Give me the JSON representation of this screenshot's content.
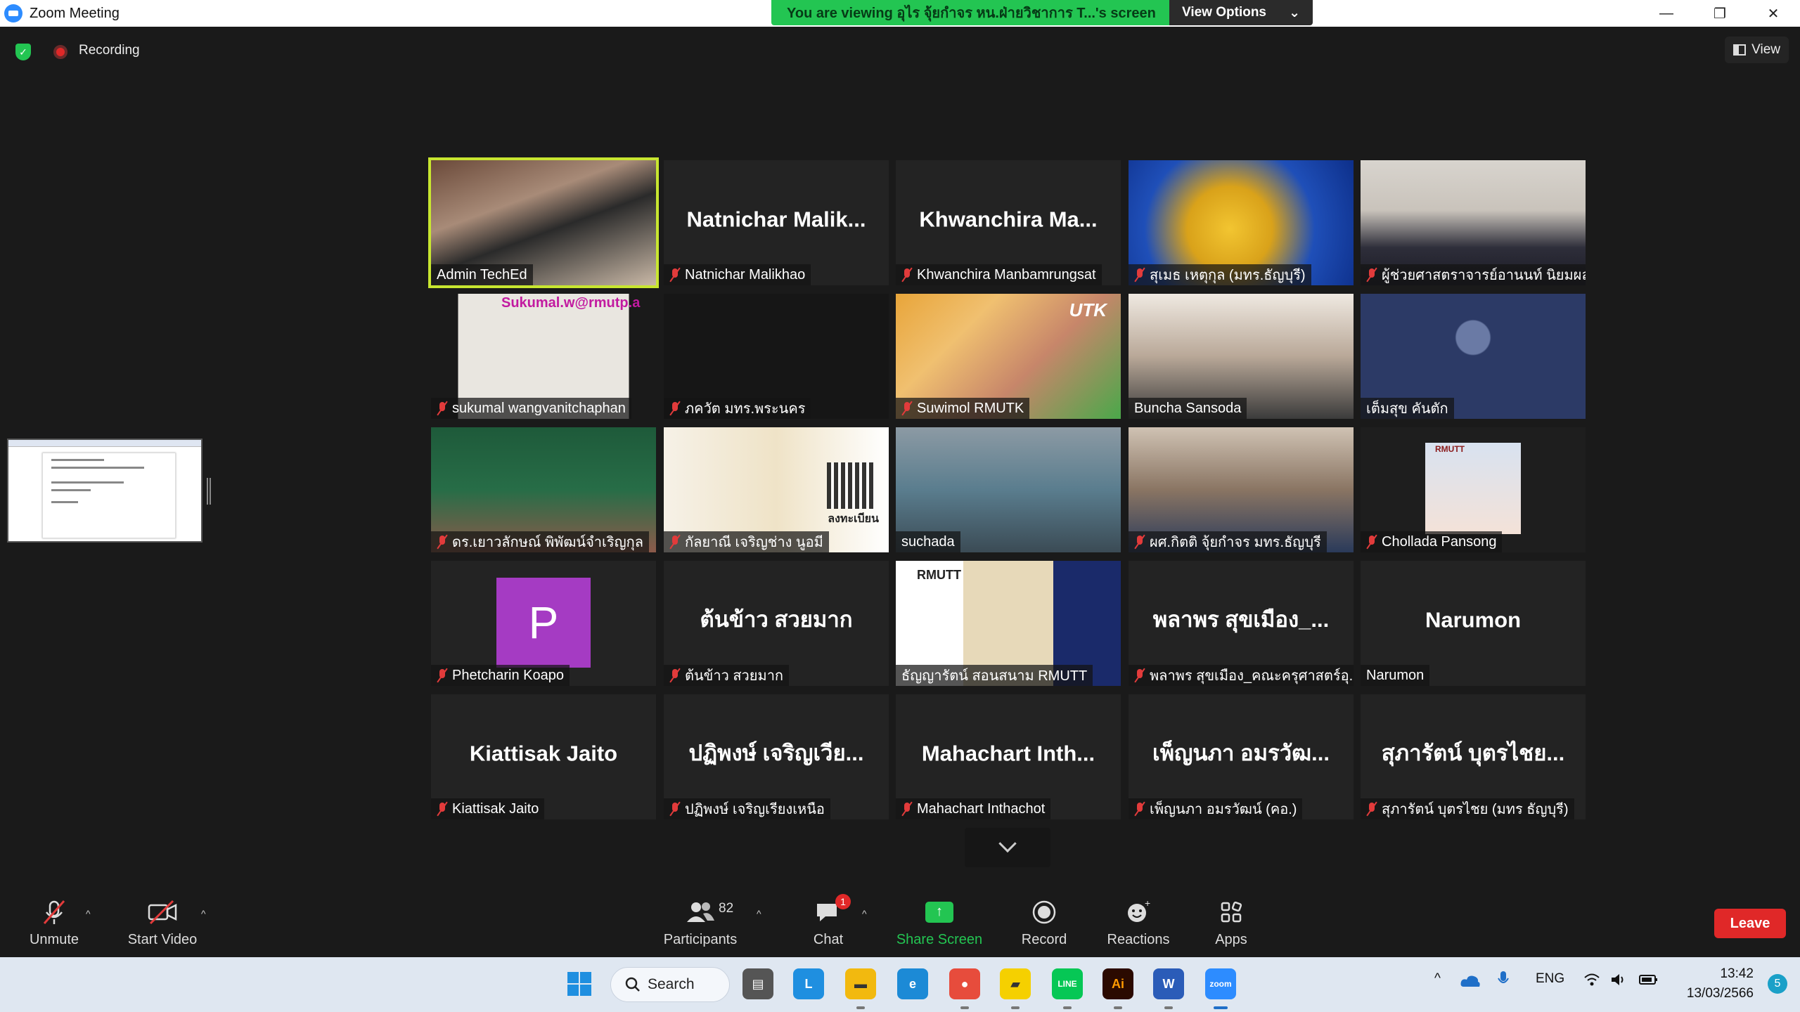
{
  "window": {
    "title": "Zoom Meeting",
    "controls": [
      "—",
      "❐",
      "✕"
    ]
  },
  "banner": {
    "message": "You are viewing อุไร จุ้ยกำจร หน.ฝ่ายวิชาการ T...'s screen",
    "options_label": "View Options",
    "options_caret": "⌄"
  },
  "status": {
    "recording_label": "Recording",
    "view_label": "View",
    "shield_glyph": "✓"
  },
  "tiles": [
    {
      "label": "Admin TechEd",
      "bigname": "",
      "muted": false,
      "active": true,
      "video": "room"
    },
    {
      "label": "Natnichar Malikhao",
      "bigname": "Natnichar  Malik...",
      "muted": true
    },
    {
      "label": "Khwanchira Manbamrungsat",
      "bigname": "Khwanchira  Ma...",
      "muted": true
    },
    {
      "label": "สุเมธ เหตุกุล (มทร.ธัญบุรี)",
      "bigname": "",
      "muted": true,
      "video": "yellow"
    },
    {
      "label": "ผู้ช่วยศาสตราจารย์อานนท์ นิยมผล",
      "bigname": "",
      "muted": true,
      "video": "suit"
    },
    {
      "label": "sukumal wangvanitchaphan",
      "bigname": "",
      "muted": true,
      "video": "bamboo",
      "overlay": "Sukumal.w@rmutp.a"
    },
    {
      "label": "ภควัต มทร.พระนคร",
      "bigname": "",
      "muted": true,
      "video": "dark"
    },
    {
      "label": "Suwimol RMUTK",
      "bigname": "",
      "muted": true,
      "video": "rmutk",
      "overlay": "UTK"
    },
    {
      "label": "Buncha Sansoda",
      "bigname": "",
      "muted": false,
      "video": "office"
    },
    {
      "label": "เต็มสุข คันตัก",
      "bigname": "",
      "muted": false,
      "video": "navy"
    },
    {
      "label": "ดร.เยาวลักษณ์ พิพัฒน์จำเริญกุล",
      "bigname": "",
      "muted": true,
      "video": "green"
    },
    {
      "label": "กัลยาณี เจริญช่าง นูอมี",
      "bigname": "",
      "muted": true,
      "video": "qr",
      "overlay": "ลงทะเบียน"
    },
    {
      "label": "suchada",
      "bigname": "",
      "muted": false,
      "video": "blur"
    },
    {
      "label": "ผศ.กิตติ จุ้ยกำจร มทร.ธัญบุรี",
      "bigname": "",
      "muted": true,
      "video": "man"
    },
    {
      "label": "Chollada Pansong",
      "bigname": "",
      "muted": true,
      "video": "card",
      "overlay": "RMUTT"
    },
    {
      "label": "Phetcharin Koapo",
      "bigname": "",
      "muted": true,
      "video": "avatar",
      "avatar": "P"
    },
    {
      "label": "ต้นข้าว สวยมาก",
      "bigname": "ต้นข้าว  สวยมาก",
      "muted": true
    },
    {
      "label": "ธัญญารัตน์ สอนสนาม RMUTT",
      "bigname": "",
      "muted": false,
      "video": "rmutt",
      "overlay": "RMUTT"
    },
    {
      "label": "พลาพร สุขเมือง_คณะครุศาสตร์อุ...",
      "bigname": "พลาพร  สุขเมือง_...",
      "muted": true
    },
    {
      "label": "Narumon",
      "bigname": "Narumon",
      "muted": false
    },
    {
      "label": "Kiattisak Jaito",
      "bigname": "Kiattisak  Jaito",
      "muted": true
    },
    {
      "label": "ปฏิพงษ์ เจริญเรียงเหนือ",
      "bigname": "ปฏิพงษ์  เจริญเวีย...",
      "muted": true
    },
    {
      "label": "Mahachart Inthachot",
      "bigname": "Mahachart  Inth...",
      "muted": true
    },
    {
      "label": "เพ็ญนภา อมรวัฒน์ (คอ.)",
      "bigname": "เพ็ญนภา  อมรวัฒ...",
      "muted": true
    },
    {
      "label": "สุภารัตน์ บุตรไชย (มทร ธัญบุรี)",
      "bigname": "สุภารัตน์  บุตรไชย...",
      "muted": true
    }
  ],
  "toolbar": {
    "unmute": "Unmute",
    "start_video": "Start Video",
    "participants": "Participants",
    "participants_count": "82",
    "chat": "Chat",
    "chat_badge": "1",
    "share_screen": "Share Screen",
    "record": "Record",
    "reactions": "Reactions",
    "apps": "Apps",
    "leave": "Leave",
    "caret": "^"
  },
  "taskbar": {
    "search": "Search",
    "tray_lang": "ENG",
    "time": "13:42",
    "date": "13/03/2566",
    "notif": "5",
    "chevron": "^",
    "apps": [
      {
        "name": "files",
        "glyph": "▤",
        "color": "#555"
      },
      {
        "name": "l-app",
        "glyph": "L",
        "color": "#1f8fe0"
      },
      {
        "name": "explorer",
        "glyph": "▬",
        "color": "#f2b90f"
      },
      {
        "name": "edge",
        "glyph": "e",
        "color": "#1c8ad6"
      },
      {
        "name": "chrome",
        "glyph": "●",
        "color": "#e74c3c"
      },
      {
        "name": "notes",
        "glyph": "▰",
        "color": "#f5d000"
      },
      {
        "name": "line",
        "glyph": "LINE",
        "color": "#06c755"
      },
      {
        "name": "illustrator",
        "glyph": "Ai",
        "color": "#2b0a00"
      },
      {
        "name": "word",
        "glyph": "W",
        "color": "#2b5cb8"
      },
      {
        "name": "zoom",
        "glyph": "zoom",
        "color": "#2d8cff"
      }
    ]
  }
}
